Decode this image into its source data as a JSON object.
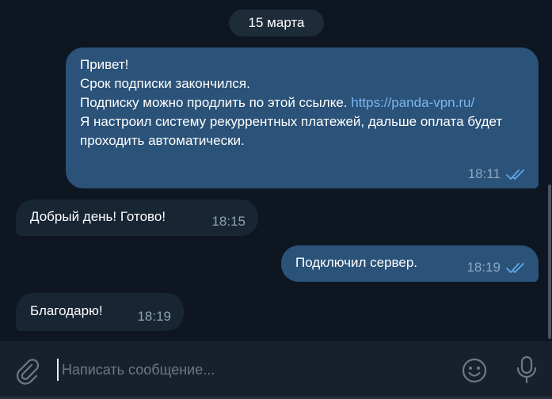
{
  "date_separator": "15 марта",
  "messages": [
    {
      "direction": "outgoing",
      "lines_before_link": "Привет!\nСрок подписки закончился.\nПодписку можно продлить по этой ссылке. ",
      "link": "https://panda-vpn.ru/",
      "lines_after_link": "Я настроил систему рекуррентных платежей, дальше оплата будет проходить автоматически.",
      "time": "18:11",
      "status": "read-double-check"
    },
    {
      "direction": "incoming",
      "text": "Добрый день! Готово!",
      "time": "18:15"
    },
    {
      "direction": "outgoing",
      "text": "Подключил сервер.",
      "time": "18:19",
      "status": "read-double-check"
    },
    {
      "direction": "incoming",
      "text": "Благодарю!",
      "time": "18:19"
    }
  ],
  "composer": {
    "placeholder": "Написать сообщение...",
    "value": "",
    "attach_icon": "paperclip-icon",
    "emoji_icon": "smiley-icon",
    "mic_icon": "microphone-icon"
  },
  "colors": {
    "background": "#0e1621",
    "outgoing_bubble": "#2b5278",
    "incoming_bubble": "#182533",
    "link": "#7ab6f0",
    "composer": "#17212b"
  }
}
